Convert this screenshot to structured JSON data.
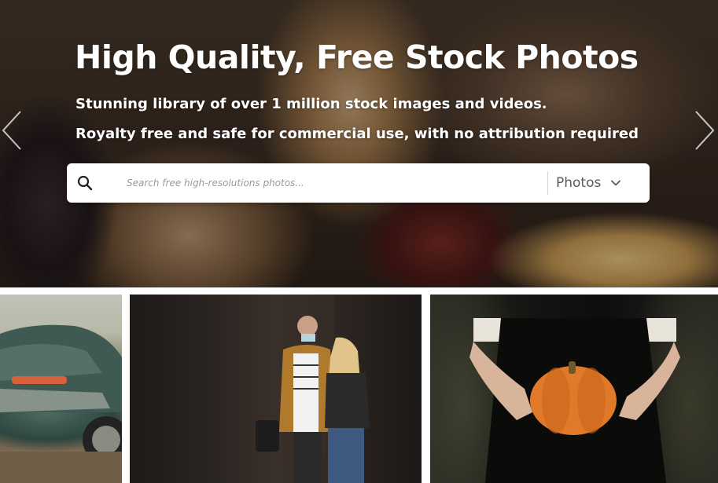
{
  "hero": {
    "title": "High Quality, Free Stock Photos",
    "subtitle_1": "Stunning library of over 1 million stock images and videos.",
    "subtitle_2": "Royalty free and safe for commercial use, with no attribution required",
    "prev_icon": "chevron-left-icon",
    "next_icon": "chevron-right-icon"
  },
  "search": {
    "placeholder": "Search free high-resolutions photos...",
    "value": "",
    "icon": "search-icon",
    "type_selected": "Photos",
    "type_icon": "chevron-down-icon"
  },
  "photos": [
    {
      "subject": "classic green car"
    },
    {
      "subject": "couple walking in street"
    },
    {
      "subject": "person holding pumpkin"
    }
  ],
  "colors": {
    "text_on_hero": "#ffffff",
    "search_bg": "#ffffff",
    "placeholder": "#9a9a9a",
    "select_text": "#5a5a5a"
  }
}
